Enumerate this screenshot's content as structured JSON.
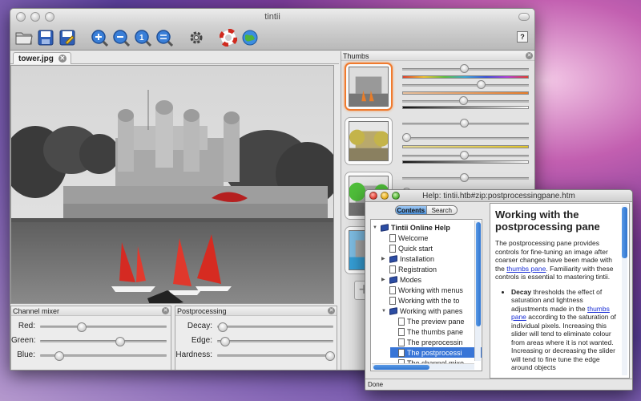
{
  "main_window": {
    "title": "tintii",
    "toolbar": {
      "buttons": [
        "open-icon",
        "save-icon",
        "export-icon",
        "zoom-in-icon",
        "zoom-out-icon",
        "zoom-fit-icon",
        "zoom-actual-icon",
        "settings-icon",
        "help-lifebuoy-icon",
        "website-globe-icon"
      ],
      "help_label": "?"
    },
    "document_tab": {
      "label": "tower.jpg"
    },
    "channel_mixer": {
      "title": "Channel mixer",
      "sliders": [
        {
          "label": "Red:",
          "value": 0.33
        },
        {
          "label": "Green:",
          "value": 0.63
        },
        {
          "label": "Blue:",
          "value": 0.15
        }
      ]
    },
    "postprocessing": {
      "title": "Postprocessing",
      "sliders": [
        {
          "label": "Decay:",
          "value": 0.05
        },
        {
          "label": "Edge:",
          "value": 0.07
        },
        {
          "label": "Hardness:",
          "value": 0.97
        }
      ]
    },
    "thumbs": {
      "title": "Thumbs",
      "add_label": "+",
      "items": [
        {
          "selected": true,
          "hue_slider": 0.49,
          "saturation_slider": 0.62,
          "lightness_slider": 0.48,
          "color": "#e87d2a"
        },
        {
          "selected": false,
          "hue_slider": 0.49,
          "saturation_slider": 0.03,
          "lightness_slider": 0.49,
          "color": "#e2c52a"
        },
        {
          "selected": false,
          "hue_slider": 0.49,
          "saturation_slider": 0.03,
          "lightness_slider": null,
          "color": "#4fbf3a"
        },
        {
          "selected": false,
          "hue_slider": null,
          "saturation_slider": null,
          "lightness_slider": null,
          "color": "#36a0d8"
        }
      ]
    }
  },
  "help_window": {
    "title": "Help: tintii.htb#zip:postprocessingpane.htm",
    "tabs": [
      "Contents",
      "Search"
    ],
    "tree": [
      {
        "label": "Tintii Online Help",
        "type": "book",
        "bold": true,
        "arrow": "▼",
        "indent": 0
      },
      {
        "label": "Welcome",
        "type": "page",
        "indent": 1
      },
      {
        "label": "Quick start",
        "type": "page",
        "indent": 1
      },
      {
        "label": "Installation",
        "type": "book",
        "arrow": "▶",
        "indent": 1
      },
      {
        "label": "Registration",
        "type": "page",
        "indent": 1
      },
      {
        "label": "Modes",
        "type": "book",
        "arrow": "▶",
        "indent": 1
      },
      {
        "label": "Working with menus",
        "type": "page",
        "indent": 1
      },
      {
        "label": "Working with the to",
        "type": "page",
        "indent": 1
      },
      {
        "label": "Working with panes",
        "type": "book",
        "arrow": "▼",
        "indent": 1
      },
      {
        "label": "The preview pane",
        "type": "page",
        "indent": 2
      },
      {
        "label": "The thumbs pane",
        "type": "page",
        "indent": 2
      },
      {
        "label": "The preprocessin",
        "type": "page",
        "indent": 2
      },
      {
        "label": "The postprocessi",
        "type": "page",
        "indent": 2,
        "selected": true
      },
      {
        "label": "The channel mixe",
        "type": "page",
        "indent": 2
      }
    ],
    "content": {
      "heading": "Working with the postprocessing pane",
      "intro_prefix": "The postprocessing pane provides controls for fine-tuning an image after coarser changes have been made with the ",
      "intro_link": "thumbs pane",
      "intro_suffix": ". Familiarity with these controls is essential to mastering tintii.",
      "bullet_term": "Decay",
      "bullet_prefix": " thresholds the effect of saturation and lightness adjustments made in the ",
      "bullet_link": "thumbs pane",
      "bullet_suffix": " according to the saturation of individual pixels. Increasing this slider will tend to eliminate colour from areas where it is not wanted. Increasing or decreasing the slider will tend to fine tune the edge around objects"
    },
    "status": "Done"
  }
}
